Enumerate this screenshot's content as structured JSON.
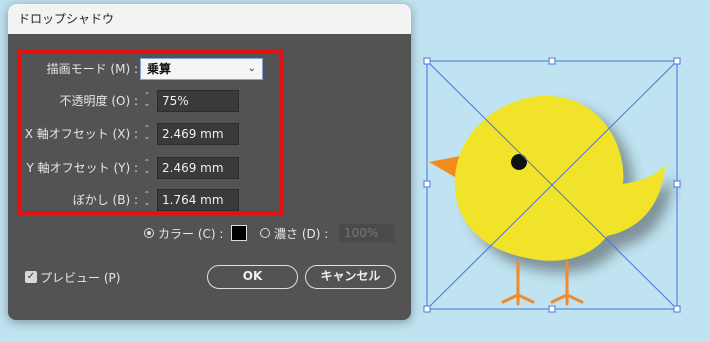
{
  "dialog": {
    "title": "ドロップシャドウ",
    "mode": {
      "label": "描画モード (M) :",
      "value": "乗算"
    },
    "opacity": {
      "label": "不透明度 (O) :",
      "value": "75%"
    },
    "x_offset": {
      "label": "X 軸オフセット (X) :",
      "value": "2.469 mm"
    },
    "y_offset": {
      "label": "Y 軸オフセット (Y) :",
      "value": "2.469 mm"
    },
    "blur": {
      "label": "ぼかし (B) :",
      "value": "1.764 mm"
    },
    "color_option": {
      "label": "カラー (C) :",
      "selected": true,
      "swatch": "#000000"
    },
    "darkness_option": {
      "label": "濃さ (D) :",
      "value": "100%"
    },
    "preview": {
      "label": "プレビュー (P)",
      "checked": true
    },
    "ok_label": "OK",
    "cancel_label": "キャンセル"
  },
  "colors": {
    "highlight": "#e21212",
    "chick_body": "#f1e32a",
    "beak": "#f28a1e",
    "legs": "#f08a2a",
    "selection": "#4a74d8",
    "background": "#bfe3f0"
  }
}
